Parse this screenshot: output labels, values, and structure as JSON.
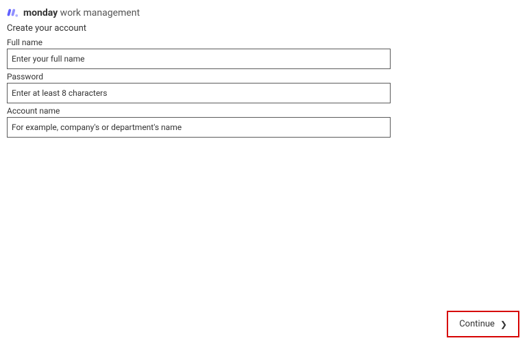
{
  "brand": {
    "bold": "monday",
    "light": " work management"
  },
  "page_title": "Create your account",
  "form": {
    "full_name": {
      "label": "Full name",
      "placeholder": "Enter your full name",
      "value": ""
    },
    "password": {
      "label": "Password",
      "placeholder": "Enter at least 8 characters",
      "value": ""
    },
    "account_name": {
      "label": "Account name",
      "placeholder": "For example, company's or department's name",
      "value": ""
    }
  },
  "continue_label": "Continue",
  "colors": {
    "highlight_border": "#d60000",
    "logo_primary": "#6161ff"
  }
}
